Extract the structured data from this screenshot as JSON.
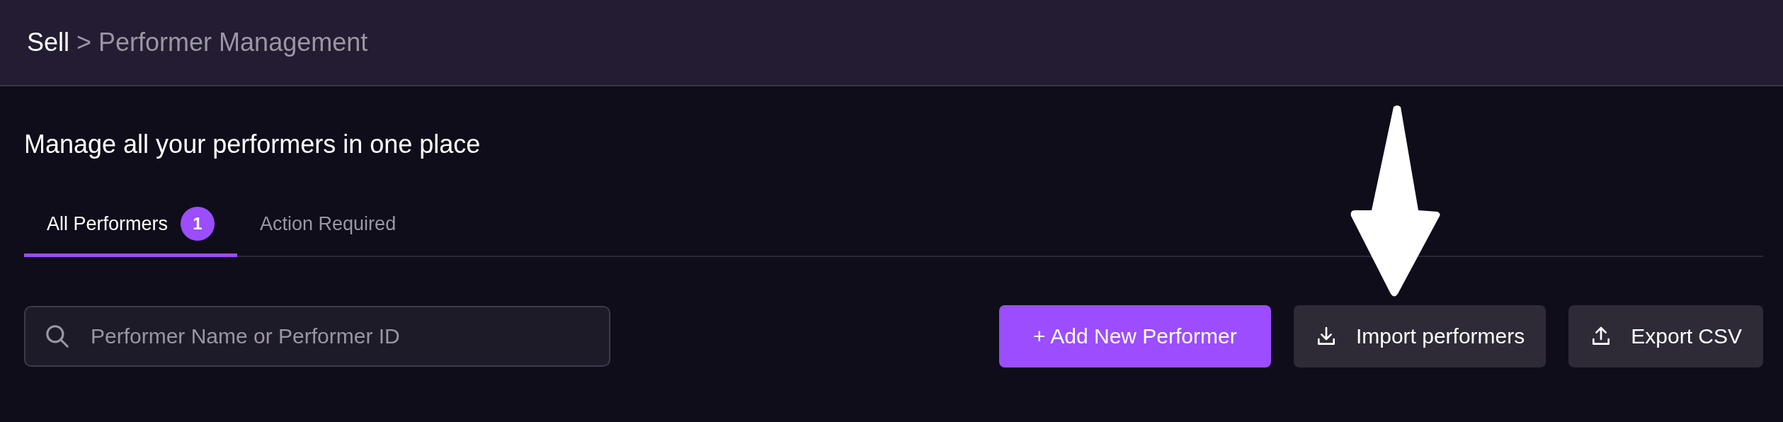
{
  "breadcrumb": {
    "parent": "Sell",
    "separator": ">",
    "current": "Performer Management"
  },
  "heading": "Manage all your performers in one place",
  "tabs": [
    {
      "label": "All Performers",
      "badge": "1",
      "selected": true
    },
    {
      "label": "Action Required",
      "selected": false
    }
  ],
  "search": {
    "placeholder": "Performer Name or Performer ID"
  },
  "buttons": [
    {
      "kind": "primary",
      "label": "+ Add New Performer"
    },
    {
      "kind": "import",
      "label": "Import performers"
    },
    {
      "kind": "export",
      "label": "Export CSV"
    }
  ],
  "annotation": {
    "kind": "arrow"
  }
}
